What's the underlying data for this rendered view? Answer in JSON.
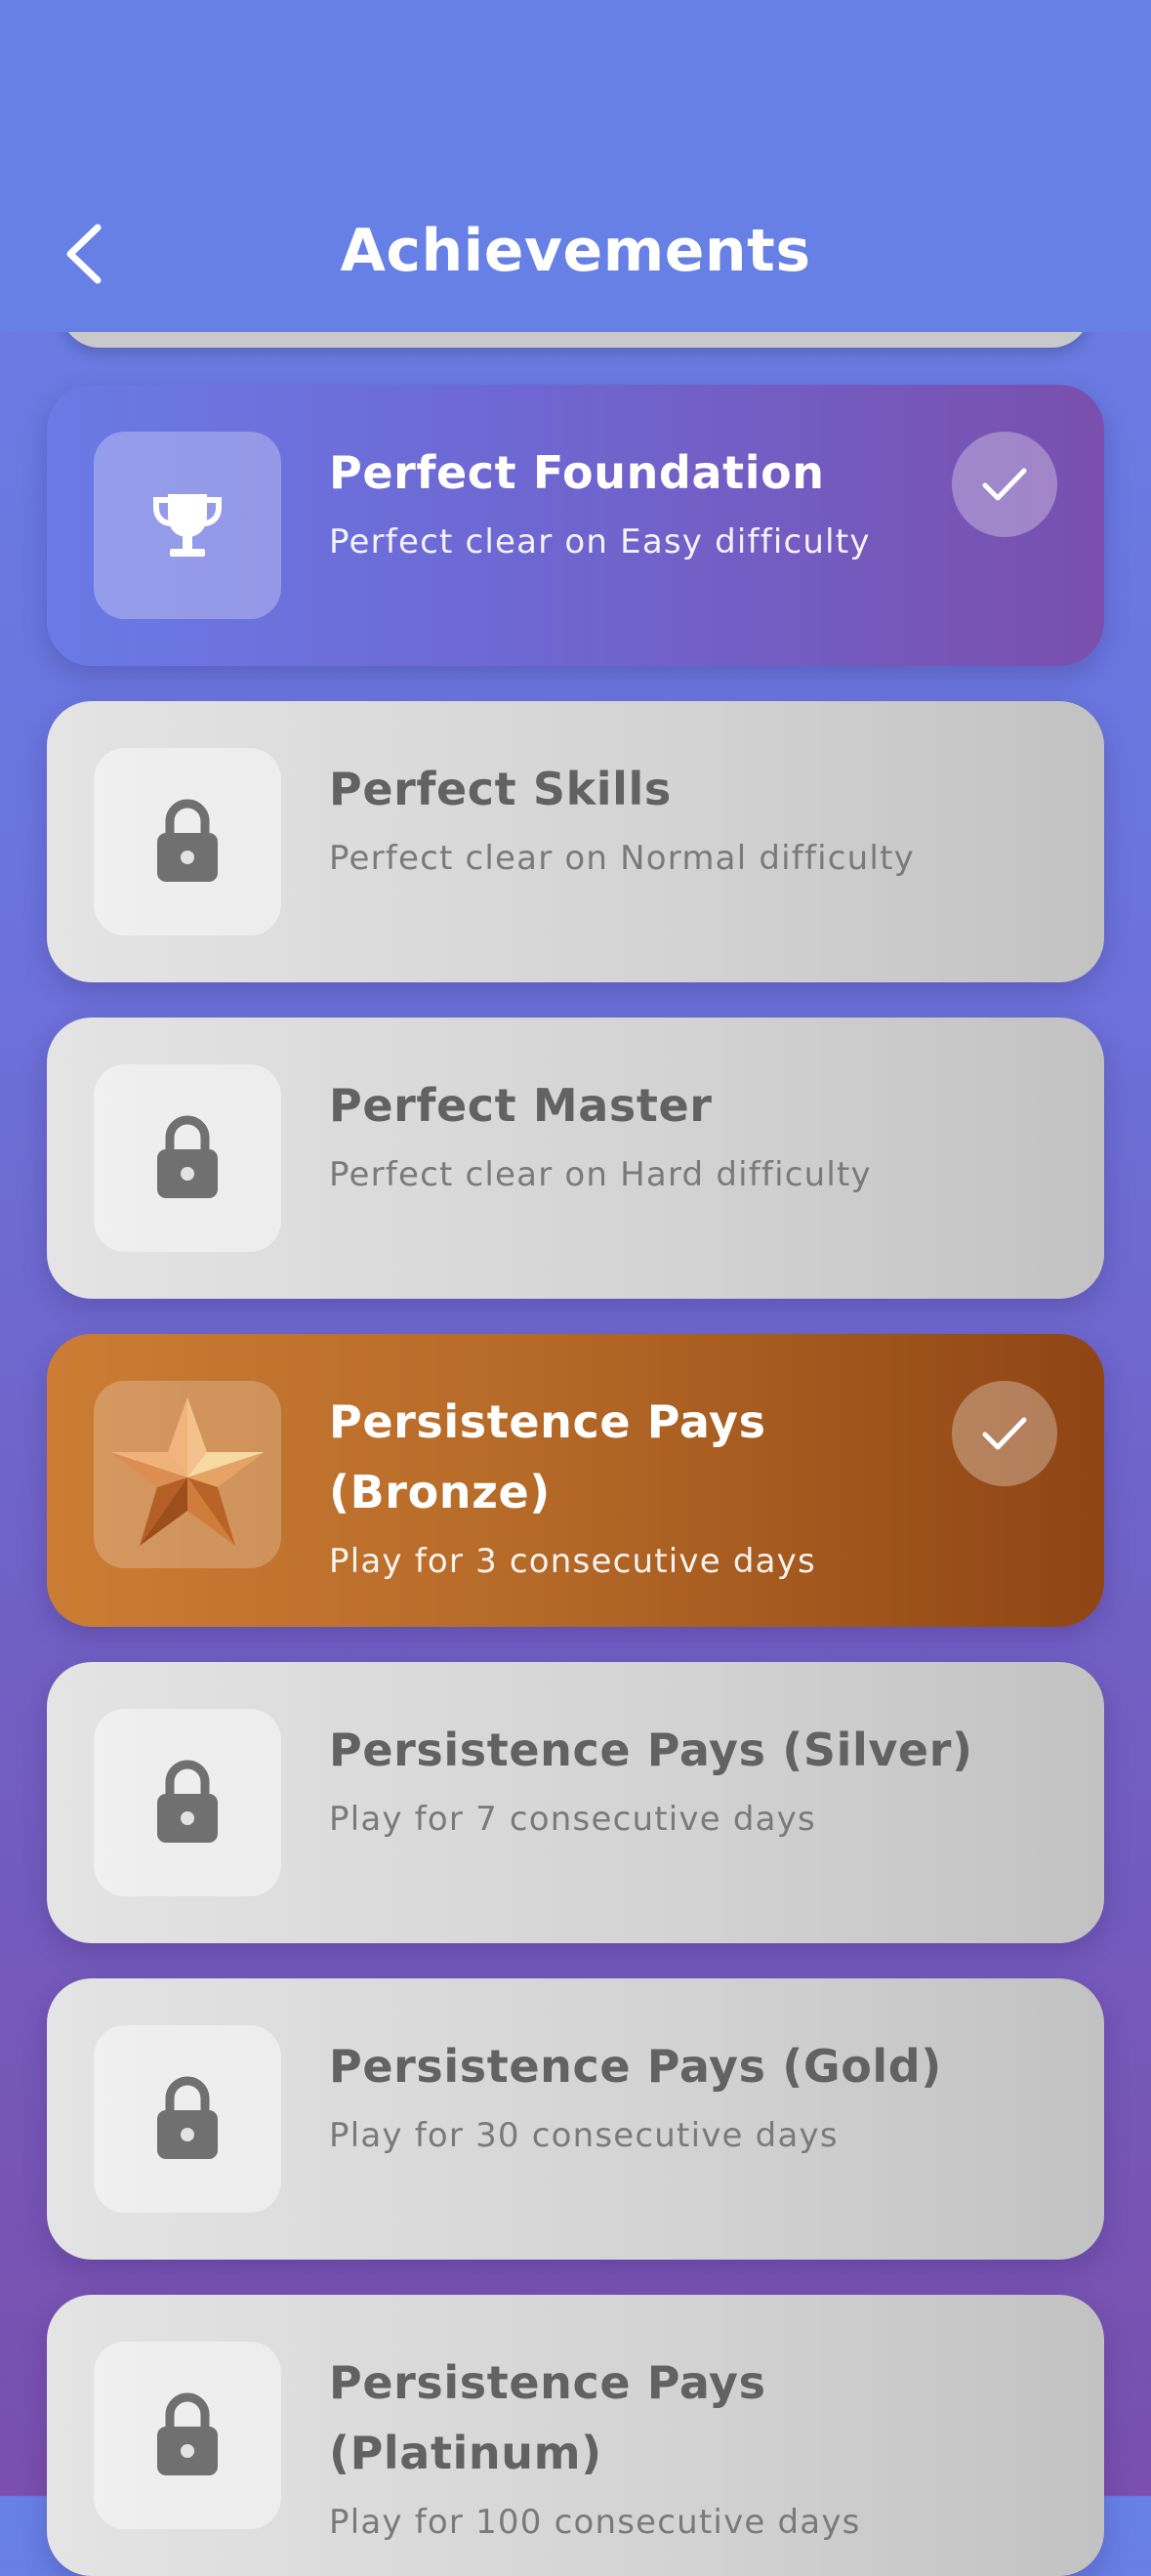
{
  "header": {
    "title": "Achievements",
    "back_icon": "chevron-left-icon"
  },
  "colors": {
    "background_top": "#6780e6",
    "background_bottom": "#7a4fad",
    "unlocked_purple": "#6e67d2",
    "unlocked_bronze": "#b66a28",
    "locked_card": "#d3d3d3",
    "locked_text": "#626262"
  },
  "achievements": [
    {
      "title": "Perfect Foundation",
      "description": "Perfect clear on Easy difficulty",
      "unlocked": true,
      "icon": "trophy-icon",
      "style": "purple"
    },
    {
      "title": "Perfect Skills",
      "description": "Perfect clear on Normal difficulty",
      "unlocked": false,
      "icon": "lock-icon",
      "style": "locked"
    },
    {
      "title": "Perfect Master",
      "description": "Perfect clear on Hard difficulty",
      "unlocked": false,
      "icon": "lock-icon",
      "style": "locked"
    },
    {
      "title": "Persistence Pays (Bronze)",
      "description": "Play for 3 consecutive days",
      "unlocked": true,
      "icon": "bronze-star-icon",
      "style": "bronze"
    },
    {
      "title": "Persistence Pays (Silver)",
      "description": "Play for 7 consecutive days",
      "unlocked": false,
      "icon": "lock-icon",
      "style": "locked"
    },
    {
      "title": "Persistence Pays (Gold)",
      "description": "Play for 30 consecutive days",
      "unlocked": false,
      "icon": "lock-icon",
      "style": "locked"
    },
    {
      "title": "Persistence Pays (Platinum)",
      "description": "Play for 100 consecutive days",
      "unlocked": false,
      "icon": "lock-icon",
      "style": "locked"
    }
  ]
}
